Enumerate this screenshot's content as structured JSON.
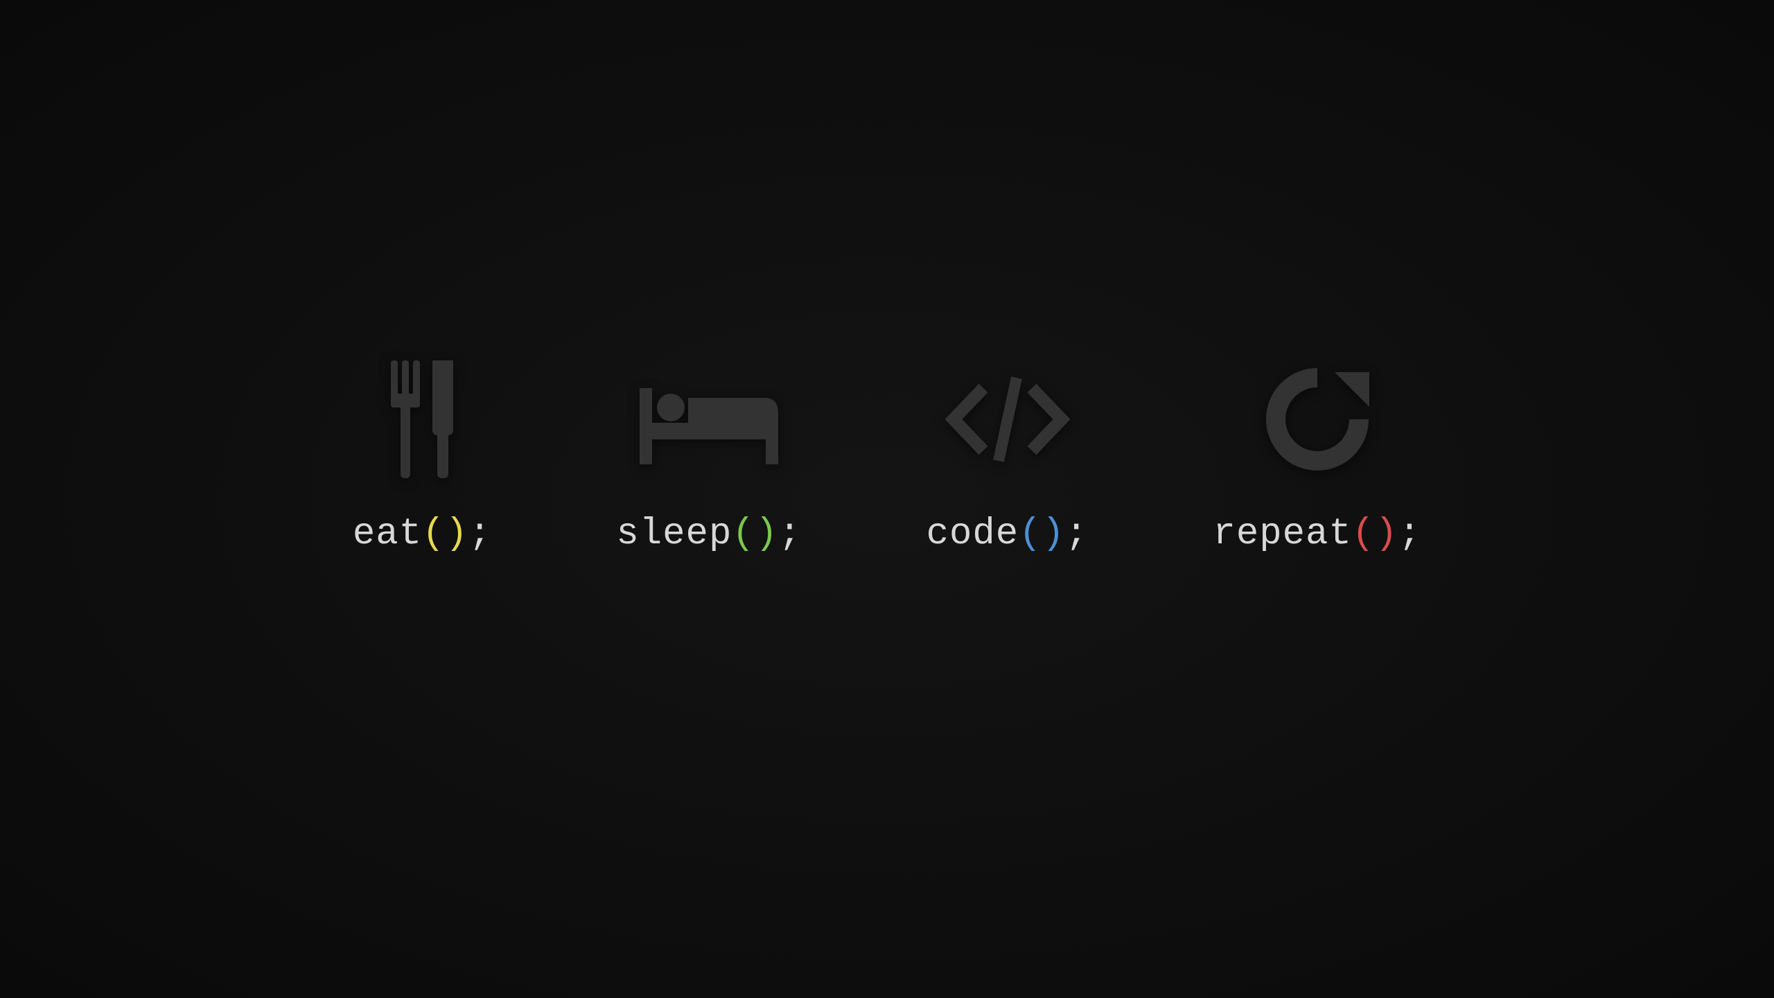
{
  "items": [
    {
      "word": "eat",
      "paren_open": "(",
      "paren_close": ")",
      "semi": ";",
      "paren_class": "paren-yellow",
      "icon": "cutlery"
    },
    {
      "word": "sleep",
      "paren_open": "(",
      "paren_close": ")",
      "semi": ";",
      "paren_class": "paren-green",
      "icon": "bed"
    },
    {
      "word": "code",
      "paren_open": "(",
      "paren_close": ")",
      "semi": ";",
      "paren_class": "paren-blue",
      "icon": "code"
    },
    {
      "word": "repeat",
      "paren_open": "(",
      "paren_close": ")",
      "semi": ";",
      "paren_class": "paren-red",
      "icon": "refresh"
    }
  ]
}
